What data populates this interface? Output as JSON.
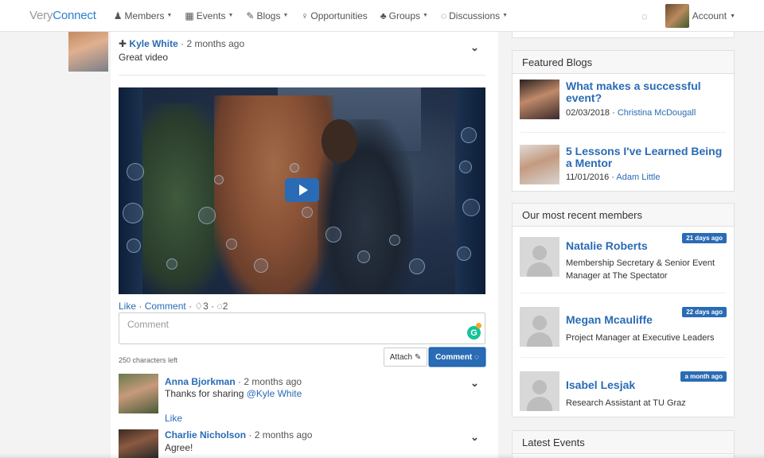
{
  "nav": {
    "brand_part1": "Very",
    "brand_part2": "Connect",
    "items": [
      {
        "icon": "user-icon",
        "glyph": "♟",
        "label": "Members"
      },
      {
        "icon": "calendar-icon",
        "glyph": "▦",
        "label": "Events"
      },
      {
        "icon": "pencil-icon",
        "glyph": "✎",
        "label": "Blogs"
      },
      {
        "icon": "lightbulb-icon",
        "glyph": "♀",
        "label": "Opportunities"
      },
      {
        "icon": "group-icon",
        "glyph": "♣",
        "label": "Groups"
      },
      {
        "icon": "chat-icon",
        "glyph": "◌",
        "label": "Discussions"
      }
    ],
    "account_label": "Account"
  },
  "post": {
    "author": "Kyle White",
    "time": "2 months ago",
    "text": "Great video",
    "like_label": "Like",
    "comment_label": "Comment",
    "likes_count": "3",
    "comments_count": "2",
    "comment_placeholder": "Comment",
    "chars_left": "250 characters left",
    "attach_label": "Attach",
    "comment_button_label": "Comment"
  },
  "comments": [
    {
      "author": "Anna Bjorkman",
      "time": "2 months ago",
      "text_prefix": "Thanks for sharing ",
      "mention": "@Kyle White",
      "like_label": "Like"
    },
    {
      "author": "Charlie Nicholson",
      "time": "2 months ago",
      "text": "Agree!"
    }
  ],
  "featured_blogs": {
    "title": "Featured Blogs",
    "items": [
      {
        "title": "What makes a successful event?",
        "date": "02/03/2018",
        "author": "Christina McDougall"
      },
      {
        "title": "5 Lessons I've Learned Being a Mentor",
        "date": "11/01/2016",
        "author": "Adam Little"
      }
    ]
  },
  "recent_members": {
    "title": "Our most recent members",
    "items": [
      {
        "name": "Natalie Roberts",
        "badge": "21 days ago",
        "role": "Membership Secretary & Senior Event Manager at The Spectator"
      },
      {
        "name": "Megan Mcauliffe",
        "badge": "22 days ago",
        "role": "Project Manager at Executive Leaders"
      },
      {
        "name": "Isabel Lesjak",
        "badge": "a month ago",
        "role": "Research Assistant at TU Graz"
      }
    ]
  },
  "latest_events": {
    "title": "Latest Events"
  },
  "colors": {
    "accent": "#2a6bb5",
    "grammarly": "#15c39a"
  }
}
